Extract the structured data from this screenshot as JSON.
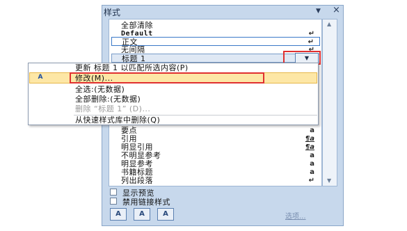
{
  "pane": {
    "title": "样式",
    "menu_glyph": "▼",
    "close_glyph": "×",
    "styles": [
      {
        "label": "全部清除",
        "mark": ""
      },
      {
        "label": "Default",
        "mark": "↵"
      },
      {
        "label": "正文",
        "mark": "↵"
      },
      {
        "label": "无间隔",
        "mark": "↵"
      },
      {
        "label": "标题 1",
        "mark": ""
      }
    ],
    "styles_lower": [
      {
        "label": "要点",
        "mark": "a"
      },
      {
        "label": "引用",
        "mark": "¶a"
      },
      {
        "label": "明显引用",
        "mark": "¶a"
      },
      {
        "label": "不明显参考",
        "mark": "a"
      },
      {
        "label": "明显参考",
        "mark": "a"
      },
      {
        "label": "书籍标题",
        "mark": "a"
      },
      {
        "label": "列出段落",
        "mark": "↵"
      }
    ],
    "dropdown_glyph": "▼",
    "show_preview": "显示预览",
    "disable_linked": "禁用链接样式",
    "tools": [
      "A",
      "A",
      "A"
    ],
    "options_link": "选项..."
  },
  "context_menu": {
    "items": [
      {
        "label": "更新 标题 1 以匹配所选内容(P)",
        "disabled": false
      },
      {
        "label": "修改(M)...",
        "disabled": false
      },
      {
        "label": "全选:(无数据)",
        "disabled": false
      },
      {
        "label": "全部删除:(无数据)",
        "disabled": false
      },
      {
        "label": "删除 “标题 1” (D)...",
        "disabled": true
      },
      {
        "label": "从快速样式库中删除(Q)",
        "disabled": false
      }
    ],
    "modify_icon_glyph": "A"
  }
}
